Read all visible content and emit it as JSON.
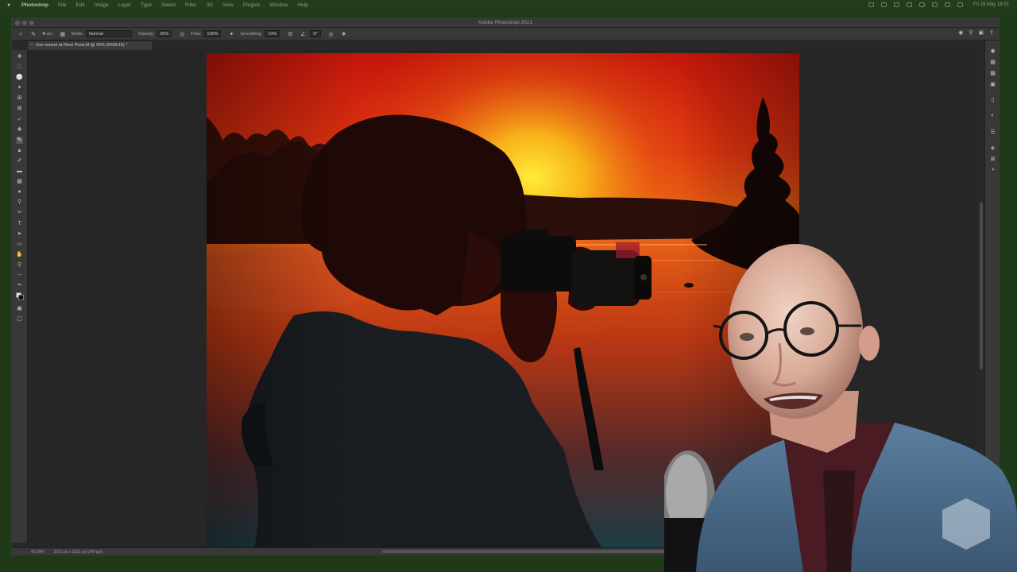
{
  "menubar": {
    "app": "Photoshop",
    "items": [
      "File",
      "Edit",
      "Image",
      "Layer",
      "Type",
      "Select",
      "Filter",
      "3D",
      "View",
      "Plugins",
      "Window",
      "Help"
    ],
    "clock": "Fri 28 May  18:01"
  },
  "window": {
    "title": "Adobe Photoshop 2021"
  },
  "options": {
    "brush_size": "250",
    "mode_label": "Mode:",
    "mode_value": "Normal",
    "opacity_label": "Opacity:",
    "opacity_value": "20%",
    "flow_label": "Flow:",
    "flow_value": "100%",
    "smoothing_label": "Smoothing:",
    "smoothing_value": "10%",
    "angle_value": "0°"
  },
  "document": {
    "tab_title": "Zoe sunset at Fleet Pond.tif @ 42% (RGB/16) *"
  },
  "status": {
    "zoom": "41.89%",
    "doc_info": "3531 px x 3531 px (240 ppi)"
  },
  "icons": {
    "toolbar": [
      "move-icon",
      "marquee-icon",
      "lasso-icon",
      "quick-select-icon",
      "crop-icon",
      "frame-icon",
      "eyedropper-icon",
      "healing-icon",
      "brush-icon",
      "clone-stamp-icon",
      "history-brush-icon",
      "eraser-icon",
      "gradient-icon",
      "blur-icon",
      "dodge-icon",
      "pen-icon",
      "type-icon",
      "path-select-icon",
      "rectangle-icon",
      "hand-icon",
      "zoom-icon",
      "more-icon"
    ],
    "right_dock": [
      "color-icon",
      "swatches-icon",
      "gradients-icon",
      "patterns-icon",
      "libraries-icon",
      "adjustments-icon",
      "properties-icon",
      "layers-icon",
      "channels-icon",
      "paths-icon"
    ]
  }
}
